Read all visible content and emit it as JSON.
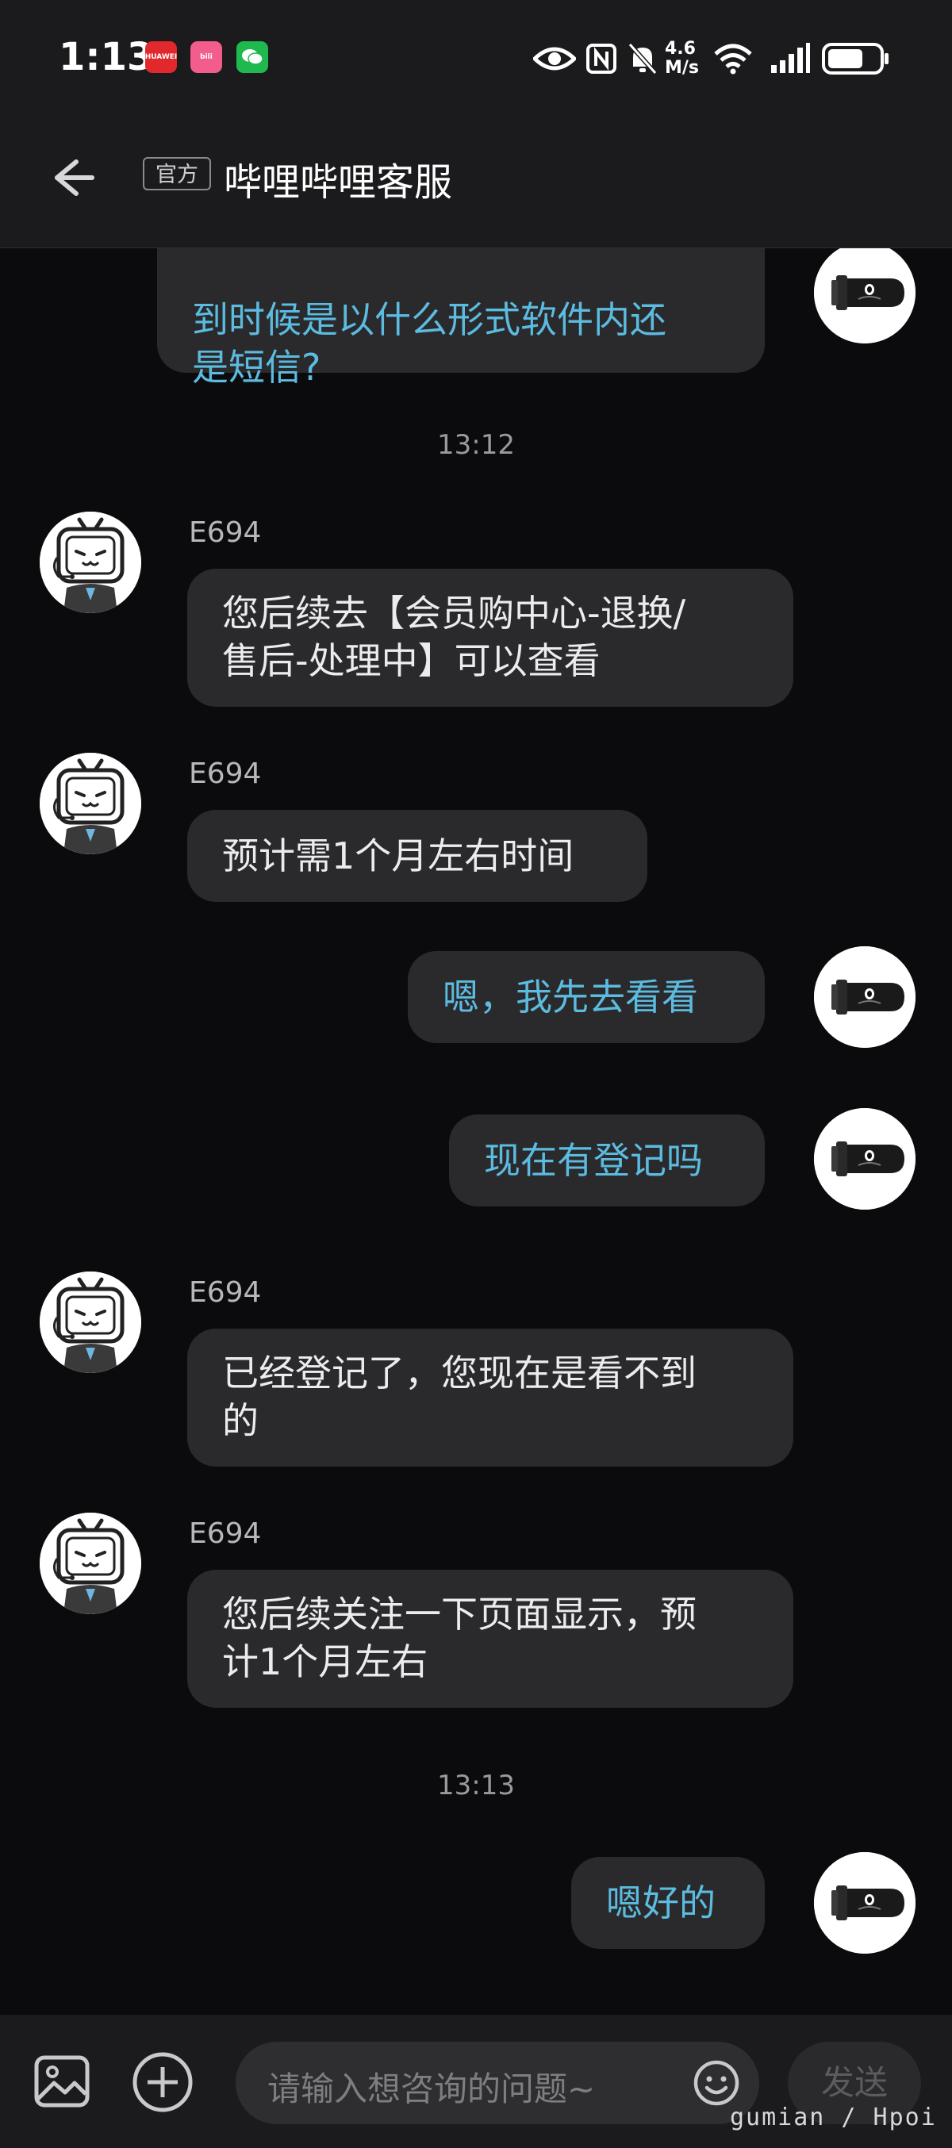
{
  "status_bar": {
    "time": "1:13",
    "notification_icons": [
      "huawei-app-icon",
      "bilibili-app-icon",
      "wechat-app-icon"
    ],
    "network_speed_value": "4.6",
    "network_speed_unit": "M/s",
    "battery_percent": 70
  },
  "header": {
    "official_tag": "官方",
    "title": "哔哩哔哩客服"
  },
  "messages": [
    {
      "sender": "me",
      "lines": [
        "到时候是以什么形式软件内还",
        "是短信?"
      ]
    },
    {
      "timestamp": "13:12"
    },
    {
      "sender": "agent",
      "nick": "E694",
      "lines": [
        "您后续去【会员购中心-退换/",
        "售后-处理中】可以查看"
      ]
    },
    {
      "sender": "agent",
      "nick": "E694",
      "lines": [
        "预计需1个月左右时间"
      ]
    },
    {
      "sender": "me",
      "lines": [
        "嗯，我先去看看"
      ]
    },
    {
      "sender": "me",
      "lines": [
        "现在有登记吗"
      ]
    },
    {
      "sender": "agent",
      "nick": "E694",
      "lines": [
        "已经登记了，您现在是看不到",
        "的"
      ]
    },
    {
      "sender": "agent",
      "nick": "E694",
      "lines": [
        "您后续关注一下页面显示，预",
        "计1个月左右"
      ]
    },
    {
      "timestamp": "13:13"
    },
    {
      "sender": "me",
      "lines": [
        "嗯好的"
      ]
    }
  ],
  "input_bar": {
    "placeholder": "请输入想咨询的问题~",
    "send_label": "发送"
  },
  "watermark": "gumian / Hpoi",
  "colors": {
    "background": "#0b0b0d",
    "bar": "#1b1b1d",
    "bubble": "#2a2a2c",
    "my_text": "#5cbbe0",
    "agent_text": "#ececee"
  }
}
